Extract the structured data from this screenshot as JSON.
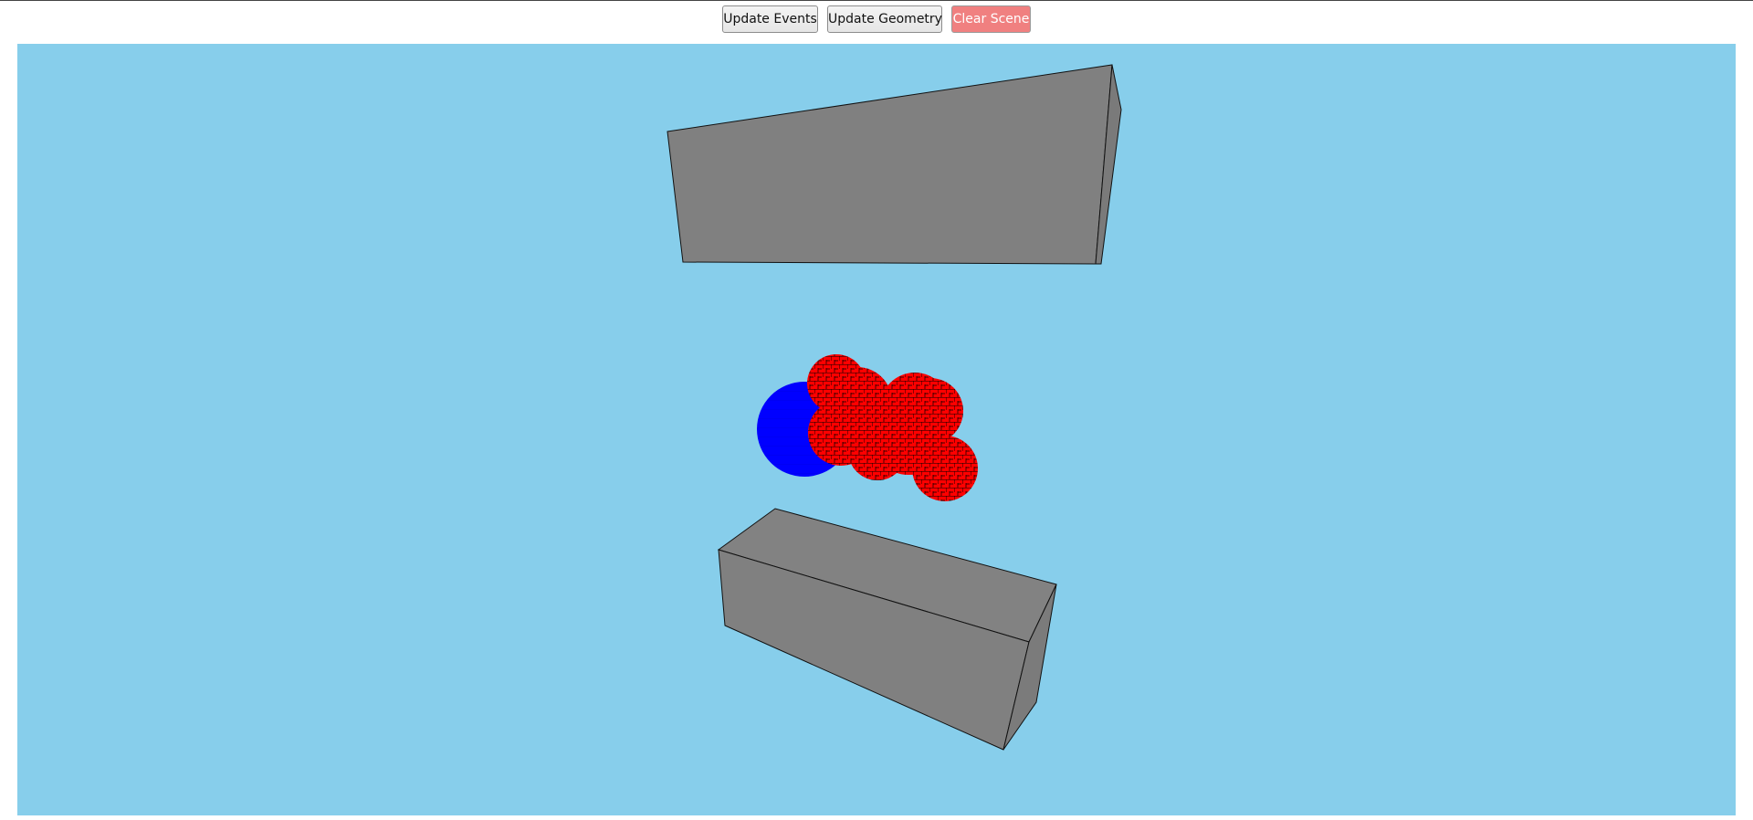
{
  "toolbar": {
    "update_events_label": "Update Events",
    "update_geometry_label": "Update Geometry",
    "clear_scene_label": "Clear Scene",
    "clear_scene_color": "#f08080"
  },
  "scene": {
    "background_color": "#87ceeb",
    "geometry_color": "#808080",
    "hit_color_red": "#ff0000",
    "hit_color_blue": "#0000ff"
  }
}
